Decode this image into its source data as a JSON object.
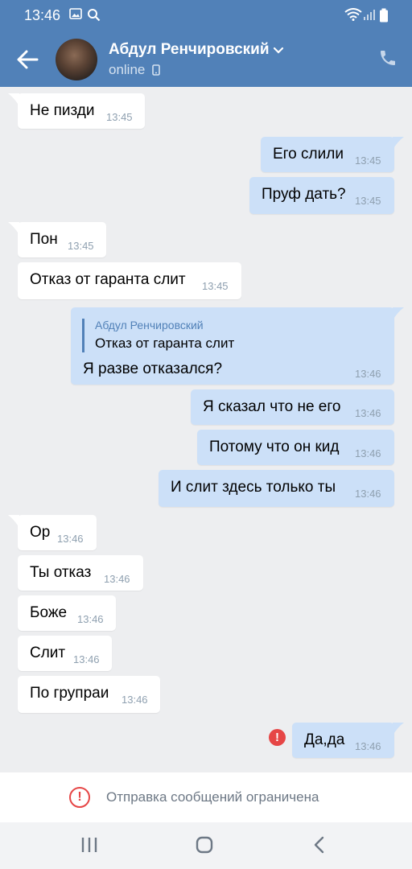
{
  "status_bar": {
    "time": "13:46"
  },
  "header": {
    "name": "Абдул Ренчировский",
    "status": "online"
  },
  "messages": [
    {
      "dir": "in",
      "text": "Не пизди",
      "time": "13:45"
    },
    {
      "dir": "out",
      "text": "Его слили",
      "time": "13:45"
    },
    {
      "dir": "out",
      "text": "Пруф дать?",
      "time": "13:45"
    },
    {
      "dir": "in",
      "text": "Пон",
      "time": "13:45"
    },
    {
      "dir": "in",
      "text": "Отказ от гаранта слит",
      "time": "13:45"
    },
    {
      "dir": "out",
      "reply_name": "Абдул Ренчировский",
      "reply_text": "Отказ от гаранта слит",
      "text": "Я разве отказался?",
      "time": "13:46"
    },
    {
      "dir": "out",
      "text": "Я сказал что не его",
      "time": "13:46"
    },
    {
      "dir": "out",
      "text": "Потому что он кид",
      "time": "13:46"
    },
    {
      "dir": "out",
      "text": "И слит здесь только ты",
      "time": "13:46"
    },
    {
      "dir": "in",
      "text": "Ор",
      "time": "13:46"
    },
    {
      "dir": "in",
      "text": "Ты отказ",
      "time": "13:46"
    },
    {
      "dir": "in",
      "text": "Боже",
      "time": "13:46"
    },
    {
      "dir": "in",
      "text": "Слит",
      "time": "13:46"
    },
    {
      "dir": "in",
      "text": "По групраи",
      "time": "13:46"
    },
    {
      "dir": "out",
      "text": "Да,да",
      "time": "13:46",
      "failed": true
    }
  ],
  "restriction": {
    "text": "Отправка сообщений ограничена"
  },
  "colors": {
    "header": "#5181b8",
    "incoming": "#ffffff",
    "outgoing": "#cce0f8",
    "error": "#e64646",
    "background": "#edeef0"
  },
  "icons": [
    "back-arrow-icon",
    "chevron-down-icon",
    "phone-icon",
    "mobile-icon",
    "error-icon",
    "recents-icon",
    "home-icon",
    "nav-back-icon"
  ]
}
